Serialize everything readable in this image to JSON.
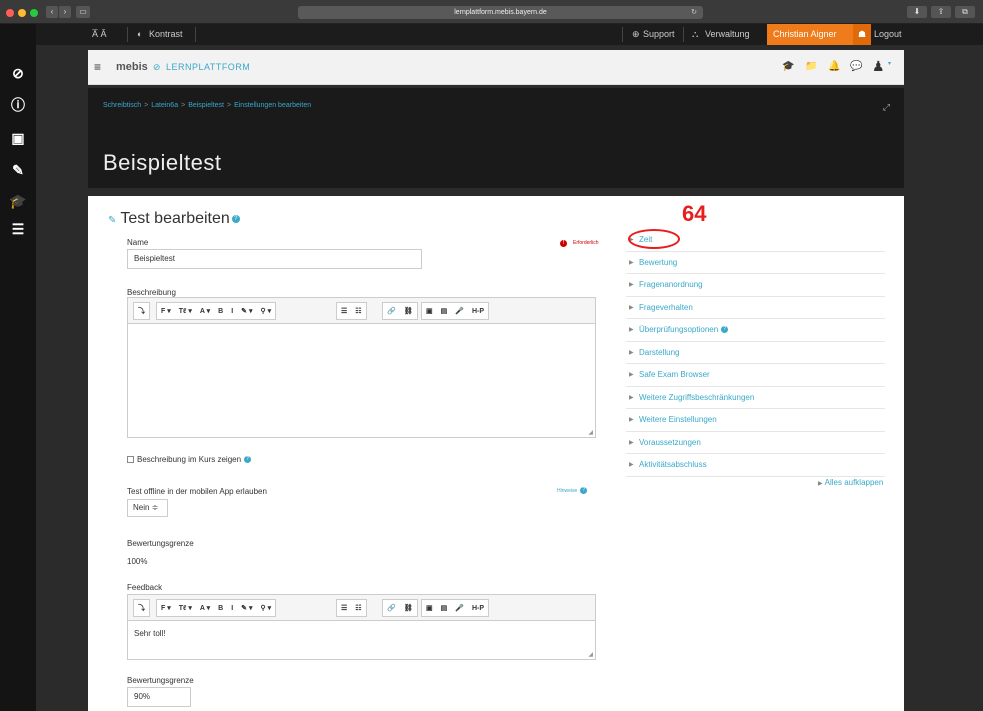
{
  "browser": {
    "url": "lernplattform.mebis.bayern.de",
    "back": "‹",
    "forward": "›",
    "sidebar_toggle": "▭",
    "reload": "↻",
    "download": "⬇",
    "share": "⇪",
    "tabs": "⧉"
  },
  "util_bar": {
    "font_size": "A̅ Ă",
    "contrast_icon": "◐",
    "contrast": "Kontrast",
    "support_icon": "⊕",
    "support": "Support",
    "verwaltung_icon": "⛬",
    "verwaltung": "Verwaltung",
    "user_name": "Christian Aigner",
    "user_icon": "☗",
    "logout": "Logout"
  },
  "header": {
    "menu_icon": "≡",
    "logo_mebis": "mebis",
    "logo_mark": "⊘",
    "logo_lernplattform": "LERNPLATTFORM",
    "icons": [
      "🎓",
      "📁",
      "🔔",
      "💬"
    ]
  },
  "hero": {
    "breadcrumb": [
      "Schreibtisch",
      "Latein6a",
      "Beispieltest",
      "Einstellungen bearbeiten"
    ],
    "breadcrumb_sep": ">",
    "expand": "⤢",
    "title": "Beispieltest"
  },
  "form": {
    "section_title": "Test bearbeiten",
    "help": "?",
    "required_icon": "!",
    "required_note": "Erforderlich",
    "name_label": "Name",
    "name_value": "Beispieltest",
    "description_label": "Beschreibung",
    "toolbar": [
      "⤵",
      "F ▾",
      "Tℓ ▾",
      "A ▾",
      "B",
      "I",
      "✎ ▾",
      "⚲ ▾",
      "☰",
      "☷",
      "🔗",
      "⛓",
      "▣",
      "▤",
      "🎤",
      "H-P"
    ],
    "description_value": "",
    "show_description_label": "Beschreibung im Kurs zeigen",
    "offline_label": "Test offline in der mobilen App erlauben",
    "offline_hint": "Hinweise",
    "offline_value": "Nein ≑",
    "grade_limit_label": "Bewertungsgrenze",
    "grade_limit_value": "100%",
    "feedback_label": "Feedback",
    "feedback_value": "Sehr toll!",
    "grade_limit2_label": "Bewertungsgrenze",
    "grade_limit2_value": "90%"
  },
  "accordion": {
    "items": [
      "Zeit",
      "Bewertung",
      "Fragenanordnung",
      "Frageverhalten",
      "Überprüfungsoptionen",
      "Darstellung",
      "Safe Exam Browser",
      "Weitere Zugriffsbeschränkungen",
      "Weitere Einstellungen",
      "Voraussetzungen",
      "Aktivitätsabschluss"
    ],
    "expand_all": "Alles aufklappen"
  },
  "annotation": {
    "number": "64"
  },
  "colors": {
    "accent": "#3aa8c9",
    "user": "#f07b1a",
    "annotation": "#e81e1e"
  }
}
